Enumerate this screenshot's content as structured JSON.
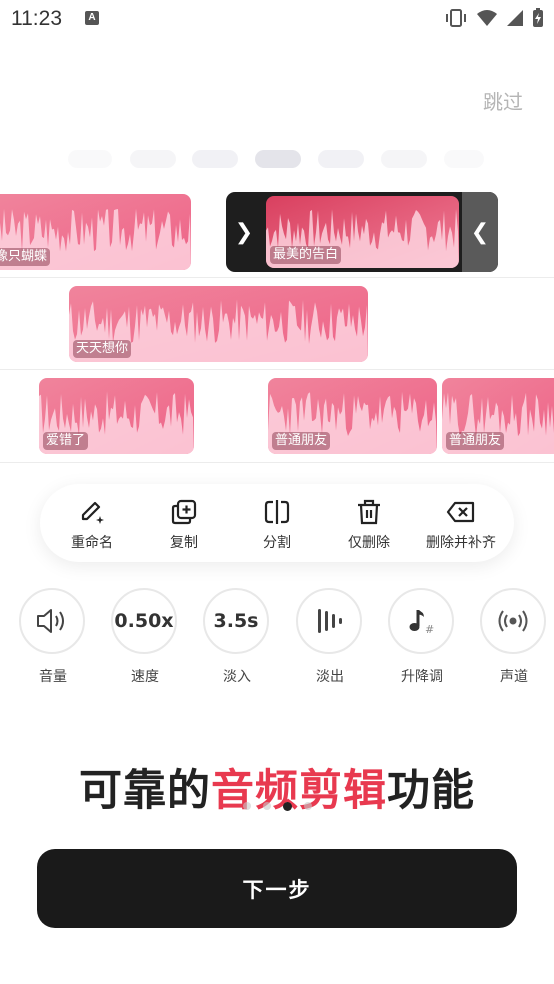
{
  "status_bar": {
    "time": "11:23",
    "notification_badge": "A"
  },
  "skip_label": "跳过",
  "tracks": [
    {
      "clips": [
        {
          "label": "像只蝴蝶"
        },
        {
          "label": "最美的告白",
          "selected": true
        }
      ]
    },
    {
      "clips": [
        {
          "label": "天天想你"
        }
      ]
    },
    {
      "clips": [
        {
          "label": "爱错了"
        },
        {
          "label": "普通朋友"
        },
        {
          "label": "普通朋友"
        }
      ]
    }
  ],
  "edit_actions": [
    {
      "icon": "pencil-sparkle-icon",
      "label": "重命名"
    },
    {
      "icon": "copy-plus-icon",
      "label": "复制"
    },
    {
      "icon": "split-icon",
      "label": "分割"
    },
    {
      "icon": "trash-icon",
      "label": "仅删除"
    },
    {
      "icon": "backspace-icon",
      "label": "删除并补齐"
    }
  ],
  "controls": [
    {
      "icon": "speaker-icon",
      "value": "",
      "label": "音量"
    },
    {
      "icon": "",
      "value": "0.50x",
      "label": "速度"
    },
    {
      "icon": "",
      "value": "3.5s",
      "label": "淡入"
    },
    {
      "icon": "fade-out-bars-icon",
      "value": "",
      "label": "淡出"
    },
    {
      "icon": "music-sharp-icon",
      "value": "",
      "label": "升降调"
    },
    {
      "icon": "broadcast-icon",
      "value": "",
      "label": "声道"
    }
  ],
  "headline": {
    "part1": "可靠的",
    "accent": "音频剪辑",
    "part2": "功能"
  },
  "pager": {
    "count": 4,
    "active_index": 2
  },
  "next_button": "下一步",
  "colors": {
    "accent": "#e8394f",
    "clip_pink": "#f27a97",
    "button_dark": "#1a1a1a"
  }
}
